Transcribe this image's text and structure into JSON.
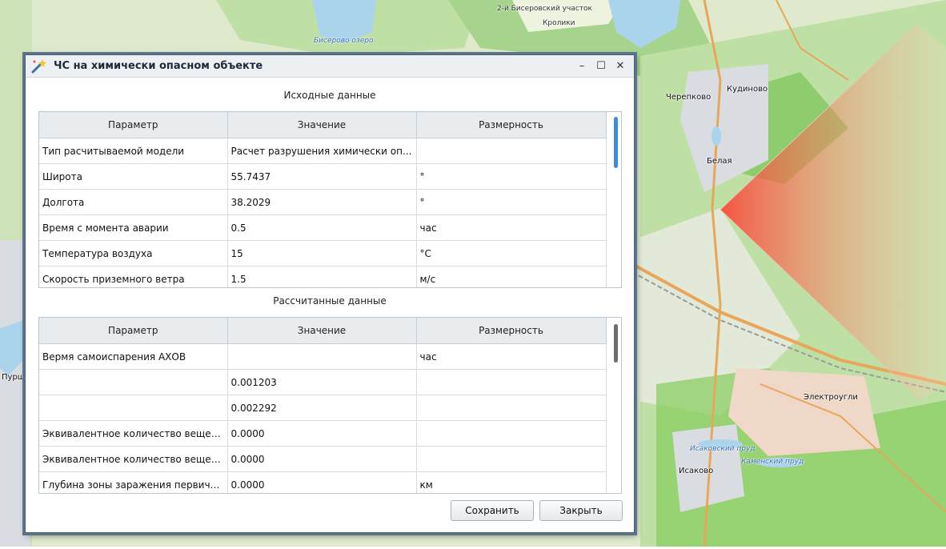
{
  "map": {
    "labels": {
      "biserovo_area": "2-й Бисеровский участок",
      "kroliki": "Кролики",
      "biserovo_lake": "Бисерово озеро",
      "cherepkovo": "Черепково",
      "kudinovo": "Кудиново",
      "belaya": "Белая",
      "elektrougli": "Электроугли",
      "isakovo": "Исаково",
      "isakovsky_pond": "Исаковский пруд",
      "kamensky_pond": "Каменский пруд",
      "purshevo": "Пурше"
    },
    "colors": {
      "forest": "#b9dca0",
      "forest_dark": "#6cc04a",
      "field": "#e6eed4",
      "water": "#aad3ec",
      "urban": "#d8dde3",
      "road": "#e8a65a",
      "plume": "#ff5a4a"
    }
  },
  "dialog": {
    "title": "ЧС на химически опасном объекте",
    "controls": {
      "minimize": "–",
      "maximize": "☐",
      "close": "✕"
    },
    "input_section": {
      "title": "Исходные данные",
      "headers": [
        "Параметр",
        "Значение",
        "Размерность"
      ],
      "rows": [
        [
          "Тип расчитываемой модели",
          "Расчет разрушения химически оп...",
          ""
        ],
        [
          "Широта",
          "55.7437",
          "°"
        ],
        [
          "Долгота",
          "38.2029",
          "°"
        ],
        [
          "Время с момента аварии",
          "0.5",
          "час"
        ],
        [
          "Температура воздуха",
          "15",
          "°C"
        ],
        [
          "Скорость приземного ветра",
          "1.5",
          "м/с"
        ]
      ]
    },
    "result_section": {
      "title": "Рассчитанные данные",
      "headers": [
        "Параметр",
        "Значение",
        "Размерность"
      ],
      "rows": [
        [
          "Вермя самоиспарения АХОВ",
          "",
          "час"
        ],
        [
          "",
          "0.001203",
          ""
        ],
        [
          "",
          "0.002292",
          ""
        ],
        [
          "Эквивалентное количество вещес...",
          "0.0000",
          ""
        ],
        [
          "Эквивалентное количество вещес...",
          "0.0000",
          ""
        ],
        [
          "Глубина зоны заражения первичн...",
          "0.0000",
          "км"
        ]
      ]
    },
    "buttons": {
      "save": "Сохранить",
      "close": "Закрыть"
    },
    "accent": "#3b8fd6"
  }
}
